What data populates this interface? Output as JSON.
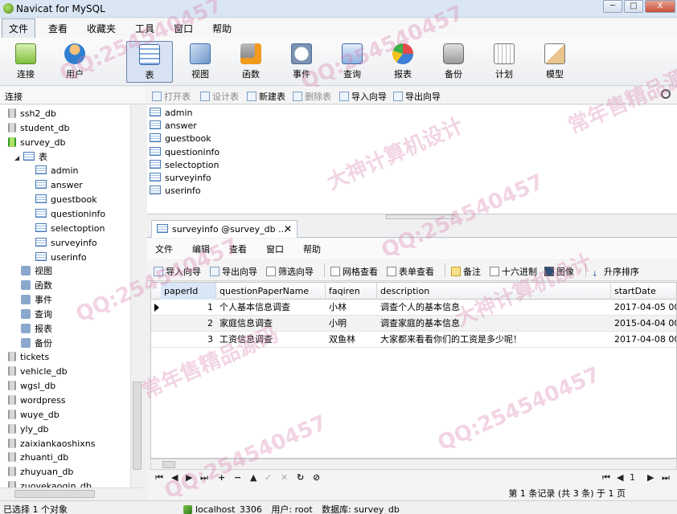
{
  "window": {
    "title": "Navicat for MySQL",
    "minimize": "─",
    "maximize": "□",
    "close": "X"
  },
  "menubar": [
    "文件",
    "查看",
    "收藏夹",
    "工具",
    "窗口",
    "帮助"
  ],
  "toolbar": [
    "连接",
    "用户",
    "表",
    "视图",
    "函数",
    "事件",
    "查询",
    "报表",
    "备份",
    "计划",
    "模型"
  ],
  "left_pane": {
    "header": "连接",
    "tree": [
      {
        "label": "ssh2_db",
        "kind": "db"
      },
      {
        "label": "student_db",
        "kind": "db"
      },
      {
        "label": "survey_db",
        "kind": "db-open"
      },
      {
        "label": "表",
        "kind": "folder"
      },
      {
        "label": "admin",
        "kind": "table"
      },
      {
        "label": "answer",
        "kind": "table"
      },
      {
        "label": "guestbook",
        "kind": "table"
      },
      {
        "label": "questioninfo",
        "kind": "table"
      },
      {
        "label": "selectoption",
        "kind": "table"
      },
      {
        "label": "surveyinfo",
        "kind": "table"
      },
      {
        "label": "userinfo",
        "kind": "table"
      },
      {
        "label": "视图",
        "kind": "object",
        "icon": "glasses-icon"
      },
      {
        "label": "函数",
        "kind": "object",
        "icon": "function-icon"
      },
      {
        "label": "事件",
        "kind": "object",
        "icon": "event-icon"
      },
      {
        "label": "查询",
        "kind": "object",
        "icon": "query-icon"
      },
      {
        "label": "报表",
        "kind": "object",
        "icon": "report-icon"
      },
      {
        "label": "备份",
        "kind": "object",
        "icon": "backup-icon"
      },
      {
        "label": "tickets",
        "kind": "db"
      },
      {
        "label": "vehicle_db",
        "kind": "db"
      },
      {
        "label": "wgsl_db",
        "kind": "db"
      },
      {
        "label": "wordpress",
        "kind": "db"
      },
      {
        "label": "wuye_db",
        "kind": "db"
      },
      {
        "label": "yly_db",
        "kind": "db"
      },
      {
        "label": "zaixiankaoshixns",
        "kind": "db"
      },
      {
        "label": "zhuanti_db",
        "kind": "db"
      },
      {
        "label": "zhuyuan_db",
        "kind": "db"
      },
      {
        "label": "zuoyekaoqin_db",
        "kind": "db"
      }
    ]
  },
  "object_toolbar": [
    {
      "label": "打开表",
      "enabled": false
    },
    {
      "label": "设计表",
      "enabled": false
    },
    {
      "label": "新建表",
      "enabled": true
    },
    {
      "label": "删除表",
      "enabled": false
    },
    {
      "label": "导入向导",
      "enabled": true
    },
    {
      "label": "导出向导",
      "enabled": true
    }
  ],
  "tables": [
    "admin",
    "answer",
    "guestbook",
    "questioninfo",
    "selectoption",
    "surveyinfo",
    "userinfo"
  ],
  "doc_tab": {
    "label": "surveyinfo @survey_db ...",
    "close": "✕"
  },
  "inner_menubar": [
    "文件",
    "编辑",
    "查看",
    "窗口",
    "帮助"
  ],
  "inner_toolbar": [
    "导入向导",
    "导出向导",
    "筛选向导",
    "网格查看",
    "表单查看",
    "备注",
    "十六进制",
    "图像",
    "升序排序"
  ],
  "grid": {
    "columns": [
      "paperId",
      "questionPaperName",
      "faqiren",
      "description",
      "startDate"
    ],
    "rows": [
      [
        "1",
        "个人基本信息调查",
        "小林",
        "调查个人的基本信息",
        "2017-04-05 00:"
      ],
      [
        "2",
        "家庭信息调查",
        "小明",
        "调查家庭的基本信息",
        "2015-04-04 00:"
      ],
      [
        "3",
        "工资信息调查",
        "双鱼林",
        "大家都来看看你们的工资是多少呢！",
        "2017-04-08 00:"
      ]
    ]
  },
  "nav": [
    "⏮",
    "◀",
    "▶",
    "⏭",
    "+",
    "−",
    "▲",
    "✓",
    "✕",
    "↻",
    "⊘"
  ],
  "nav_right": {
    "first": "⏮",
    "prev": "◀",
    "page": "1",
    "next": "▶",
    "last": "⏭"
  },
  "record_status": "第 1 条记录 (共 3 条) 于 1 页",
  "statusbar": {
    "selection": "已选择 1 个对象",
    "host": "localhost_3306",
    "user": "用户: root",
    "database": "数据库: survey_db"
  },
  "watermarks": [
    "QQ:254540457",
    "大神计算机设计",
    "常年售精品源码"
  ],
  "colors": {
    "selected_tab": "#d7e3f3",
    "watermark": "#d678aa"
  }
}
